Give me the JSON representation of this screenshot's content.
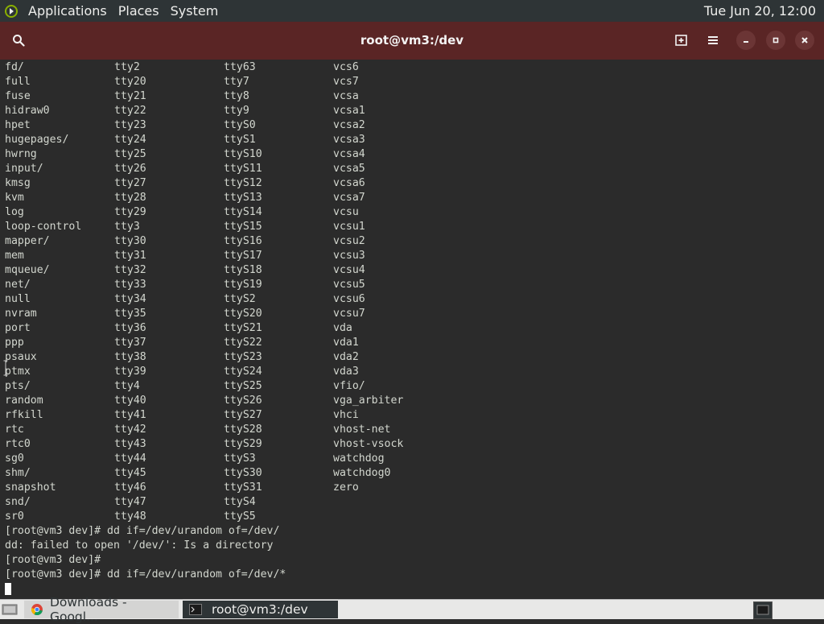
{
  "top_panel": {
    "applications": "Applications",
    "places": "Places",
    "system": "System",
    "clock": "Tue Jun 20, 12:00"
  },
  "window": {
    "title": "root@vm3:/dev"
  },
  "terminal": {
    "ls_rows": [
      [
        "fd/",
        "tty2",
        "tty63",
        "vcs6"
      ],
      [
        "full",
        "tty20",
        "tty7",
        "vcs7"
      ],
      [
        "fuse",
        "tty21",
        "tty8",
        "vcsa"
      ],
      [
        "hidraw0",
        "tty22",
        "tty9",
        "vcsa1"
      ],
      [
        "hpet",
        "tty23",
        "ttyS0",
        "vcsa2"
      ],
      [
        "hugepages/",
        "tty24",
        "ttyS1",
        "vcsa3"
      ],
      [
        "hwrng",
        "tty25",
        "ttyS10",
        "vcsa4"
      ],
      [
        "input/",
        "tty26",
        "ttyS11",
        "vcsa5"
      ],
      [
        "kmsg",
        "tty27",
        "ttyS12",
        "vcsa6"
      ],
      [
        "kvm",
        "tty28",
        "ttyS13",
        "vcsa7"
      ],
      [
        "log",
        "tty29",
        "ttyS14",
        "vcsu"
      ],
      [
        "loop-control",
        "tty3",
        "ttyS15",
        "vcsu1"
      ],
      [
        "mapper/",
        "tty30",
        "ttyS16",
        "vcsu2"
      ],
      [
        "mem",
        "tty31",
        "ttyS17",
        "vcsu3"
      ],
      [
        "mqueue/",
        "tty32",
        "ttyS18",
        "vcsu4"
      ],
      [
        "net/",
        "tty33",
        "ttyS19",
        "vcsu5"
      ],
      [
        "null",
        "tty34",
        "ttyS2",
        "vcsu6"
      ],
      [
        "nvram",
        "tty35",
        "ttyS20",
        "vcsu7"
      ],
      [
        "port",
        "tty36",
        "ttyS21",
        "vda"
      ],
      [
        "ppp",
        "tty37",
        "ttyS22",
        "vda1"
      ],
      [
        "psaux",
        "tty38",
        "ttyS23",
        "vda2"
      ],
      [
        "ptmx",
        "tty39",
        "ttyS24",
        "vda3"
      ],
      [
        "pts/",
        "tty4",
        "ttyS25",
        "vfio/"
      ],
      [
        "random",
        "tty40",
        "ttyS26",
        "vga_arbiter"
      ],
      [
        "rfkill",
        "tty41",
        "ttyS27",
        "vhci"
      ],
      [
        "rtc",
        "tty42",
        "ttyS28",
        "vhost-net"
      ],
      [
        "rtc0",
        "tty43",
        "ttyS29",
        "vhost-vsock"
      ],
      [
        "sg0",
        "tty44",
        "ttyS3",
        "watchdog"
      ],
      [
        "shm/",
        "tty45",
        "ttyS30",
        "watchdog0"
      ],
      [
        "snapshot",
        "tty46",
        "ttyS31",
        "zero"
      ],
      [
        "snd/",
        "tty47",
        "ttyS4",
        ""
      ],
      [
        "sr0",
        "tty48",
        "ttyS5",
        ""
      ]
    ],
    "lines": [
      "[root@vm3 dev]# dd if=/dev/urandom of=/dev/",
      "dd: failed to open '/dev/': Is a directory",
      "[root@vm3 dev]#",
      "[root@vm3 dev]# dd if=/dev/urandom of=/dev/*"
    ]
  },
  "taskbar": {
    "tasks": [
      {
        "label": "Downloads - Googl...",
        "icon": "chrome-icon"
      },
      {
        "label": "root@vm3:/dev",
        "icon": "terminal-icon"
      }
    ]
  },
  "colors": {
    "header_bg": "#5a2525",
    "terminal_bg": "#2b2b2b",
    "terminal_fg": "#d3d7cf",
    "panel_bg": "#2e3436"
  }
}
